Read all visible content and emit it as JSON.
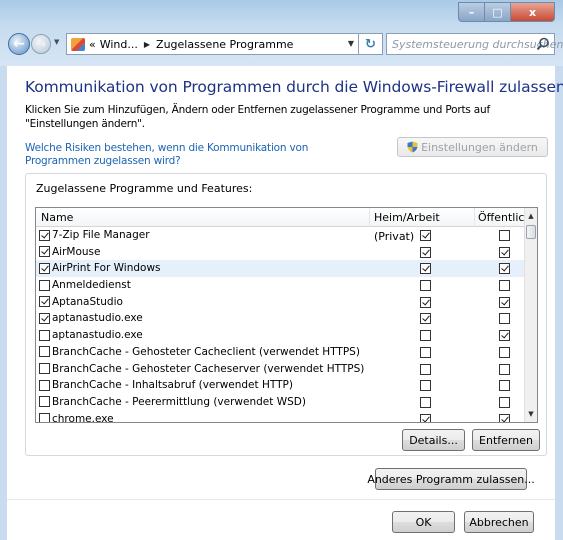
{
  "window": {
    "caption": {
      "minimize": "–",
      "maximize": "□",
      "close": "x"
    }
  },
  "nav": {
    "back": "←",
    "forward": "→",
    "breadcrumb_prefix": "«",
    "breadcrumb": [
      "Wind...",
      "Zugelassene Programme"
    ],
    "refresh": "↻",
    "search_placeholder": "Systemsteuerung durchsuchen"
  },
  "main": {
    "title": "Kommunikation von Programmen durch die Windows-Firewall zulassen",
    "description": "Klicken Sie zum Hinzufügen, Ändern oder Entfernen zugelassener Programme und Ports auf \"Einstellungen ändern\".",
    "risk_link": "Welche Risiken bestehen, wenn die Kommunikation von Programmen zugelassen wird?",
    "settings_button": "Einstellungen ändern",
    "group_label": "Zugelassene Programme und Features:",
    "columns": {
      "name": "Name",
      "private": "Heim/Arbeit (Privat)",
      "public": "Öffentlich"
    },
    "rows": [
      {
        "name": "7-Zip File Manager",
        "enabled": true,
        "private": true,
        "public": false,
        "selected": false
      },
      {
        "name": "AirMouse",
        "enabled": true,
        "private": true,
        "public": true,
        "selected": false
      },
      {
        "name": "AirPrint For Windows",
        "enabled": true,
        "private": true,
        "public": true,
        "selected": true
      },
      {
        "name": "Anmeldedienst",
        "enabled": false,
        "private": false,
        "public": false,
        "selected": false
      },
      {
        "name": "AptanaStudio",
        "enabled": true,
        "private": true,
        "public": true,
        "selected": false
      },
      {
        "name": "aptanastudio.exe",
        "enabled": true,
        "private": true,
        "public": false,
        "selected": false
      },
      {
        "name": "aptanastudio.exe",
        "enabled": false,
        "private": false,
        "public": true,
        "selected": false
      },
      {
        "name": "BranchCache - Gehosteter Cacheclient (verwendet HTTPS)",
        "enabled": false,
        "private": false,
        "public": false,
        "selected": false
      },
      {
        "name": "BranchCache - Gehosteter Cacheserver (verwendet HTTPS)",
        "enabled": false,
        "private": false,
        "public": false,
        "selected": false
      },
      {
        "name": "BranchCache - Inhaltsabruf (verwendet HTTP)",
        "enabled": false,
        "private": false,
        "public": false,
        "selected": false
      },
      {
        "name": "BranchCache - Peerermittlung (verwendet WSD)",
        "enabled": false,
        "private": false,
        "public": false,
        "selected": false
      },
      {
        "name": "chrome.exe",
        "enabled": false,
        "private": true,
        "public": true,
        "selected": false
      }
    ],
    "details_button": "Details...",
    "remove_button": "Entfernen",
    "allow_other_button": "Anderes Programm zulassen...",
    "ok_button": "OK",
    "cancel_button": "Abbrechen"
  },
  "colors": {
    "title": "#1e3287",
    "link": "#1c64b4",
    "selected_row": "#e5f0fb"
  },
  "icons": {
    "back": "back-arrow-icon",
    "forward": "forward-arrow-icon",
    "address": "control-panel-icon",
    "search": "search-icon",
    "settings": "shield-icon"
  }
}
